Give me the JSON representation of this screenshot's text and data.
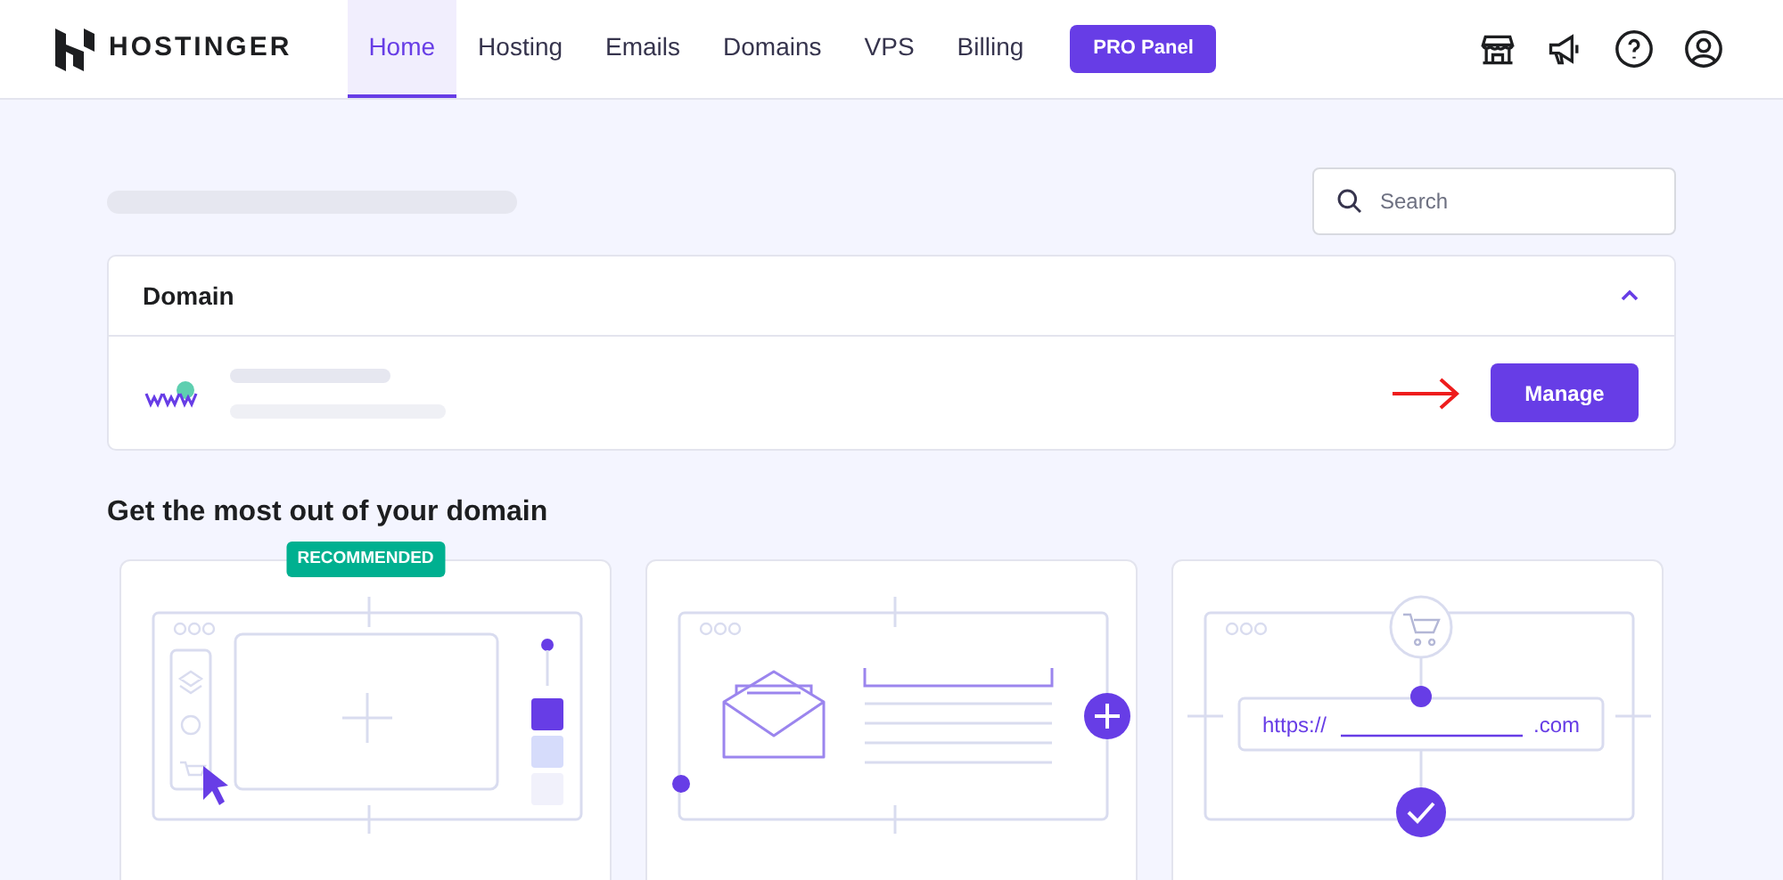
{
  "header": {
    "logo": "HOSTINGER",
    "nav": [
      {
        "label": "Home",
        "selected": true
      },
      {
        "label": "Hosting",
        "selected": false
      },
      {
        "label": "Emails",
        "selected": false
      },
      {
        "label": "Domains",
        "selected": false
      },
      {
        "label": "VPS",
        "selected": false
      },
      {
        "label": "Billing",
        "selected": false
      }
    ],
    "pro_button": "PRO Panel"
  },
  "search": {
    "placeholder": "Search"
  },
  "domain_panel": {
    "title": "Domain",
    "expanded": true,
    "button": "Manage"
  },
  "section_title": "Get the most out of your domain",
  "cards": [
    {
      "kind": "builder",
      "badge": "RECOMMENDED"
    },
    {
      "kind": "email"
    },
    {
      "kind": "url",
      "url_prefix": "https://",
      "url_suffix": ".com"
    }
  ]
}
